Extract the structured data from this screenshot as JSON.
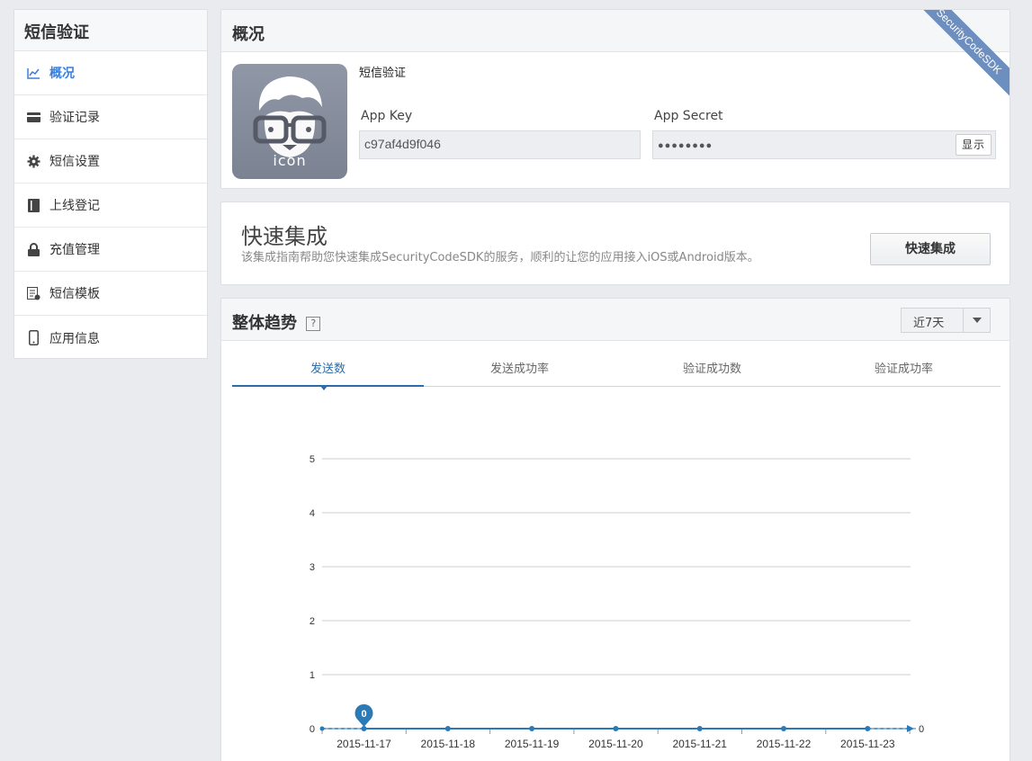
{
  "sidebar": {
    "title": "短信验证",
    "items": [
      {
        "label": "概况",
        "icon": "chart-icon",
        "active": true
      },
      {
        "label": "验证记录",
        "icon": "card-icon"
      },
      {
        "label": "短信设置",
        "icon": "gear-icon"
      },
      {
        "label": "上线登记",
        "icon": "book-icon"
      },
      {
        "label": "充值管理",
        "icon": "lock-icon"
      },
      {
        "label": "短信模板",
        "icon": "template-icon"
      },
      {
        "label": "应用信息",
        "icon": "phone-icon"
      }
    ]
  },
  "overview": {
    "title": "概况",
    "ribbon": "SecurityCodeSDK",
    "app_icon_text": "icon",
    "app_name": "短信验证",
    "app_key_label": "App Key",
    "app_key_value": "c97af4d9f046",
    "app_secret_label": "App Secret",
    "app_secret_value": "●●●●●●●●",
    "show_button": "显示"
  },
  "quick": {
    "title": "快速集成",
    "desc": "该集成指南帮助您快速集成SecurityCodeSDK的服务，顺利的让您的应用接入iOS或Android版本。",
    "button": "快速集成"
  },
  "trend": {
    "title": "整体趋势",
    "help": "?",
    "range": "近7天",
    "tabs": [
      "发送数",
      "发送成功率",
      "验证成功数",
      "验证成功率"
    ],
    "active_tab": 0
  },
  "chart_data": {
    "type": "line",
    "categories": [
      "2015-11-17",
      "2015-11-18",
      "2015-11-19",
      "2015-11-20",
      "2015-11-21",
      "2015-11-22",
      "2015-11-23"
    ],
    "values": [
      0,
      0,
      0,
      0,
      0,
      0,
      0
    ],
    "ylim": [
      0,
      5
    ],
    "yticks": [
      0,
      1,
      2,
      3,
      4,
      5
    ],
    "grid": true,
    "highlight_label": "0",
    "end_label": "0",
    "color": "#2a7ab8"
  },
  "colors": {
    "accent": "#3b7fd9",
    "series": "#2a7ab8",
    "ribbon": "#6d8fbf"
  }
}
